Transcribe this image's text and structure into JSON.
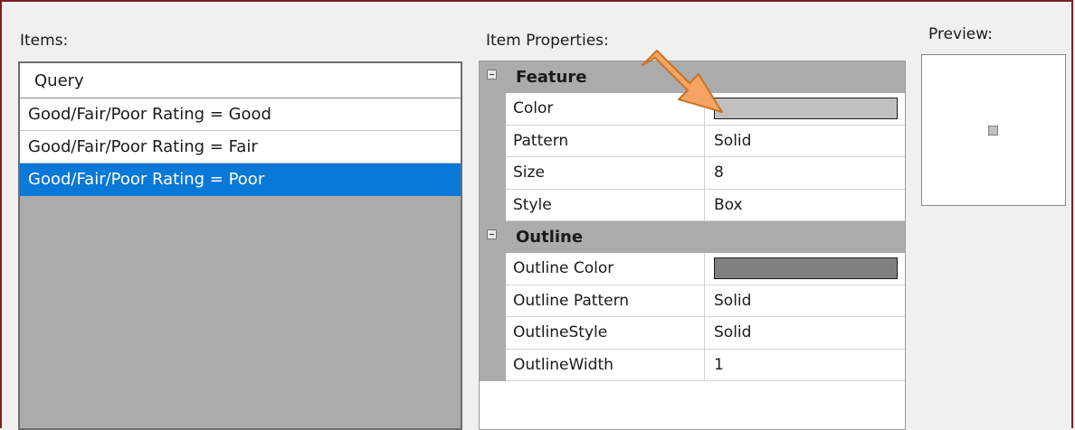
{
  "items": {
    "label": "Items:",
    "header": "Query",
    "rows": [
      {
        "text": "Good/Fair/Poor Rating = Good",
        "selected": false
      },
      {
        "text": "Good/Fair/Poor Rating = Fair",
        "selected": false
      },
      {
        "text": "Good/Fair/Poor Rating = Poor",
        "selected": true
      }
    ]
  },
  "properties": {
    "label": "Item Properties:",
    "categories": [
      {
        "name": "Feature",
        "props": [
          {
            "name": "Color",
            "value": "",
            "swatch": "#c0c0c0"
          },
          {
            "name": "Pattern",
            "value": "Solid"
          },
          {
            "name": "Size",
            "value": "8"
          },
          {
            "name": "Style",
            "value": "Box"
          }
        ]
      },
      {
        "name": "Outline",
        "props": [
          {
            "name": "Outline Color",
            "value": "",
            "swatch": "#808080"
          },
          {
            "name": "Outline Pattern",
            "value": "Solid"
          },
          {
            "name": "OutlineStyle",
            "value": "Solid"
          },
          {
            "name": "OutlineWidth",
            "value": "1"
          }
        ]
      }
    ]
  },
  "preview": {
    "label": "Preview:",
    "symbol_fill": "#c0c0c0",
    "symbol_outline": "#808080"
  },
  "annotation": {
    "arrow_color": "#f4a460"
  },
  "colors": {
    "selection": "#0a78d7",
    "frame": "#7b2121"
  }
}
